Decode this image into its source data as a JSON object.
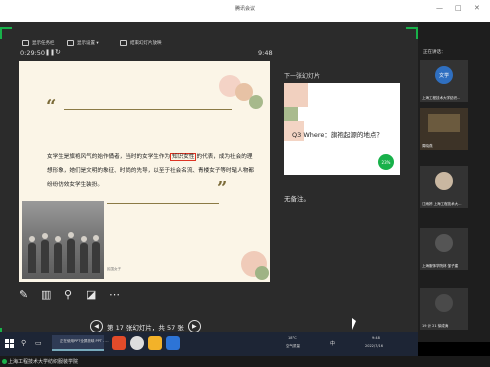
{
  "window": {
    "title": "腾讯会议",
    "controls": [
      "—",
      "□",
      "✕"
    ]
  },
  "toolbar": {
    "items": [
      {
        "label": "显示任务栏",
        "icon": "taskbar-icon"
      },
      {
        "label": "显示设置 ▾",
        "icon": "settings-icon"
      },
      {
        "label": "结束幻灯片放映",
        "icon": "end-show-icon"
      }
    ]
  },
  "presenter": {
    "timer": "0:29:50",
    "pause_glyph": "❚❚",
    "reset_glyph": "↻",
    "clock": "9:48",
    "next_label": "下一张幻灯片",
    "no_notes": "无备注。"
  },
  "slide": {
    "quote_open": "“",
    "quote_close": "”",
    "text_before": "女学生是旗袍风气的始作俑者，当时的女学生作为",
    "text_highlight": "知识女性",
    "text_after": "的代表，成为社会的理想形象，她们是文明的象征、时尚的先导，以至于社会名流、青楼女子等时髦人物都纷纷仿效女学生装扮。",
    "caption": "民国女子"
  },
  "next_slide": {
    "question": "Q3 Where：旗袍起源的地点？",
    "badge": "23%"
  },
  "navigation": {
    "prev_glyph": "◀",
    "next_glyph": "▶",
    "status": "第 17 张幻灯片，共 57 张"
  },
  "tools": [
    "✎",
    "▥",
    "⚲",
    "◪",
    "⋯"
  ],
  "participants": {
    "header": "正在讲话：",
    "tiles": [
      {
        "label": "上海工程技术大学纺织...",
        "avatar": "文学"
      },
      {
        "label": "周晓燕"
      },
      {
        "label": "江雨婷  上海工程技术大..."
      },
      {
        "label": "上海服饰学院林  邹子建"
      },
      {
        "label": "19 计 21 徐成涛"
      }
    ]
  },
  "taskbar": {
    "active_app": "正在使用PPT全屏放映  PPT - ...",
    "weather": "18°C",
    "weather_sub": "空气质量",
    "ime": "中",
    "time": "9:48",
    "date": "2022/7/16"
  },
  "share_bar": {
    "label": "上海工程技术大学纺织服装学院"
  },
  "colors": {
    "accent_green": "#18b14a",
    "slide_bg": "#fbf5e7",
    "highlight_box": "#dd3322"
  }
}
